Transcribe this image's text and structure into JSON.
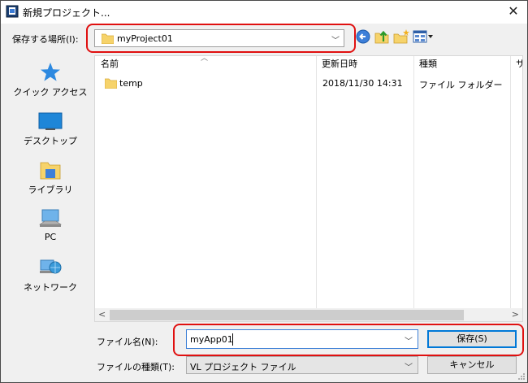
{
  "window": {
    "title": "新規プロジェクト...",
    "close_symbol": "✕"
  },
  "location": {
    "label": "保存する場所(I):",
    "current": "myProject01"
  },
  "places": [
    {
      "label": "クイック アクセス",
      "icon": "star-icon"
    },
    {
      "label": "デスクトップ",
      "icon": "desktop-icon"
    },
    {
      "label": "ライブラリ",
      "icon": "library-icon"
    },
    {
      "label": "PC",
      "icon": "pc-icon"
    },
    {
      "label": "ネットワーク",
      "icon": "network-icon"
    }
  ],
  "columns": [
    "名前",
    "更新日時",
    "種類",
    "サ"
  ],
  "files": [
    {
      "name": "temp",
      "modified": "2018/11/30 14:31",
      "type": "ファイル フォルダー"
    }
  ],
  "form": {
    "filename_label": "ファイル名(N):",
    "filename_value": "myApp01",
    "filetype_label": "ファイルの種類(T):",
    "filetype_value": "VL プロジェクト ファイル",
    "save_label": "保存(S)",
    "cancel_label": "キャンセル"
  },
  "colors": {
    "highlight": "#e01010",
    "accent": "#0078d7",
    "folder": "#f6d36b"
  }
}
